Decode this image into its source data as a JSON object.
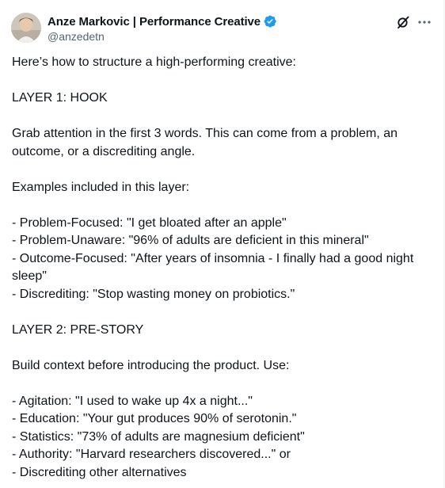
{
  "author": {
    "display_name": "Anze Markovic | Performance Creative",
    "handle": "@anzedetn",
    "verified": true,
    "verified_color": "#1d9bf0"
  },
  "icons": {
    "grok": "grok-icon",
    "more": "more-icon",
    "verified": "verified-badge-icon"
  },
  "post": {
    "lines": [
      "Here’s how to structure a high-performing creative:",
      "",
      "LAYER 1: HOOK",
      "",
      "Grab attention in the first 3 words. This can come from a problem, an",
      "outcome, or a discrediting angle.",
      "",
      "Examples included in this layer:",
      "",
      "- Problem-Focused: \"I get bloated after an apple\"",
      "- Problem-Unaware: \"96% of adults are deficient in this mineral\"",
      "- Outcome-Focused: \"After years of insomnia - I finally had a good night",
      "sleep\"",
      "- Discrediting: \"Stop wasting money on probiotics.\"",
      "",
      "LAYER 2: PRE-STORY",
      "",
      "Build context before introducing the product. Use:",
      "",
      "- Agitation: \"I used to wake up 4x a night...\"",
      "- Education: \"Your gut produces 90% of serotonin.\"",
      "- Statistics: \"73% of adults are magnesium deficient\"",
      "- Authority: \"Harvard researchers discovered...\" or",
      "- Discrediting other alternatives"
    ]
  }
}
